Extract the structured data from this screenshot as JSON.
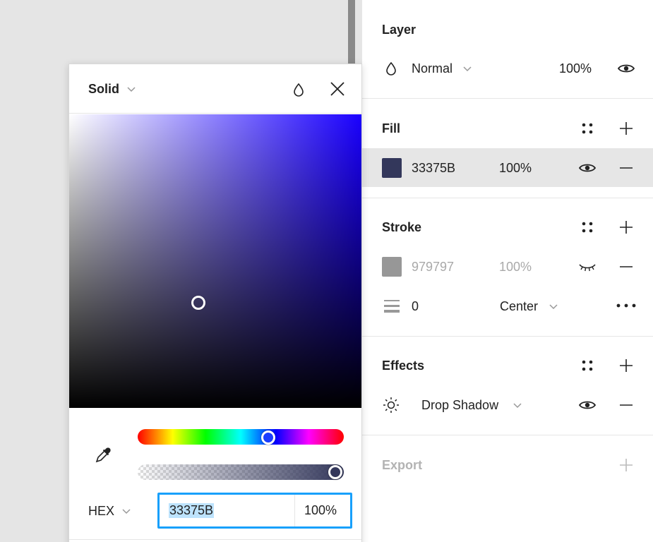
{
  "layer": {
    "title": "Layer",
    "blend_mode": "Normal",
    "opacity": "100%"
  },
  "fill": {
    "title": "Fill",
    "hex": "33375B",
    "opacity": "100%",
    "swatch_color": "#33375B"
  },
  "stroke": {
    "title": "Stroke",
    "hex": "979797",
    "opacity": "100%",
    "swatch_color": "#979797",
    "weight": "0",
    "position": "Center"
  },
  "effects": {
    "title": "Effects",
    "effect_type": "Drop Shadow"
  },
  "export": {
    "title": "Export"
  },
  "picker": {
    "fill_type": "Solid",
    "color_format": "HEX",
    "hex_value": "33375B",
    "opacity": "100%",
    "hue_color": "#1A00FF",
    "accent_color": "#18A0FB"
  }
}
